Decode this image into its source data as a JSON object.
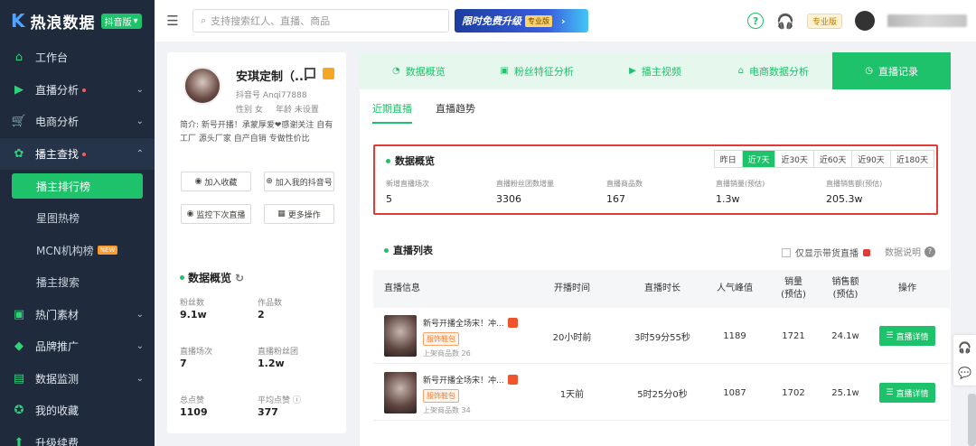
{
  "app": {
    "brand": "热浪数据",
    "platform": "抖音版"
  },
  "sidebar": {
    "items": [
      {
        "label": "工作台",
        "icon": "home-icon"
      },
      {
        "label": "直播分析",
        "icon": "live-icon",
        "dot": true
      },
      {
        "label": "电商分析",
        "icon": "cart-icon"
      },
      {
        "label": "播主查找",
        "icon": "gear-icon",
        "dot": true
      },
      {
        "label": "热门素材",
        "icon": "video-icon"
      },
      {
        "label": "品牌推广",
        "icon": "cube-icon"
      },
      {
        "label": "数据监测",
        "icon": "chart-icon"
      },
      {
        "label": "我的收藏",
        "icon": "star-icon"
      },
      {
        "label": "升级续费",
        "icon": "upgrade-icon"
      }
    ],
    "sub_items": [
      {
        "label": "播主排行榜"
      },
      {
        "label": "星图热榜"
      },
      {
        "label": "MCN机构榜",
        "badge": "NEW"
      },
      {
        "label": "播主搜索"
      }
    ]
  },
  "topbar": {
    "search_placeholder": "支持搜索红人、直播、商品",
    "banner_text": "限时免费升级",
    "banner_badge": "专业版",
    "pro_badge": "专业版"
  },
  "profile": {
    "name": "安琪定制（...",
    "douyin_id": "抖音号 Anqi77888",
    "gender": "性别 女",
    "age": "年龄 未设置",
    "bio": "简介: 新号开播！承蒙厚爱❤感谢关注 自有工厂 源头厂家 自产自销 专做性价比",
    "buttons": {
      "favorite": "加入收藏",
      "add_douyin": "加入我的抖音号",
      "monitor": "监控下次直播",
      "more": "更多操作"
    },
    "overview_title": "数据概览",
    "stats": [
      {
        "label": "粉丝数",
        "value": "9.1w"
      },
      {
        "label": "作品数",
        "value": "2"
      },
      {
        "label": "直播场次",
        "value": "7"
      },
      {
        "label": "直播粉丝团",
        "value": "1.2w"
      },
      {
        "label": "总点赞",
        "value": "1109"
      },
      {
        "label": "平均点赞",
        "value": "377"
      }
    ]
  },
  "main": {
    "tabs": [
      {
        "label": "数据概览",
        "icon": "pie-icon"
      },
      {
        "label": "粉丝特征分析",
        "icon": "fans-icon"
      },
      {
        "label": "播主视频",
        "icon": "video-icon"
      },
      {
        "label": "电商数据分析",
        "icon": "shop-icon"
      },
      {
        "label": "直播记录",
        "icon": "clock-icon",
        "active": true
      }
    ],
    "subtabs": [
      {
        "label": "近期直播",
        "active": true
      },
      {
        "label": "直播趋势"
      }
    ],
    "overview": {
      "title": "数据概览",
      "ranges": [
        "昨日",
        "近7天",
        "近30天",
        "近60天",
        "近90天",
        "近180天"
      ],
      "active_range": "近7天",
      "stats": [
        {
          "label": "新增直播场次",
          "value": "5"
        },
        {
          "label": "直播粉丝团数增量",
          "value": "3306"
        },
        {
          "label": "直播商品数",
          "value": "167"
        },
        {
          "label": "直播销量(预估)",
          "value": "1.3w"
        },
        {
          "label": "直播销售额(预估)",
          "value": "205.3w"
        }
      ]
    },
    "list": {
      "title": "直播列表",
      "checkbox_label": "仅显示带货直播",
      "data_note": "数据说明",
      "columns": [
        "直播信息",
        "开播时间",
        "直播时长",
        "人气峰值",
        "销量\n(预估)",
        "销售额\n(预估)",
        "操作"
      ],
      "rows": [
        {
          "title": "新号开播全场宋！冲...",
          "tag": "服饰鞋包",
          "sub": "上架商品数 26",
          "start": "20小时前",
          "duration": "3时59分55秒",
          "peak": "1189",
          "sales": "1721",
          "revenue": "24.1w",
          "action": "直播详情"
        },
        {
          "title": "新号开播全场宋！冲...",
          "tag": "服饰鞋包",
          "sub": "上架商品数 34",
          "start": "1天前",
          "duration": "5时25分0秒",
          "peak": "1087",
          "sales": "1702",
          "revenue": "25.1w",
          "action": "直播详情"
        }
      ]
    }
  }
}
